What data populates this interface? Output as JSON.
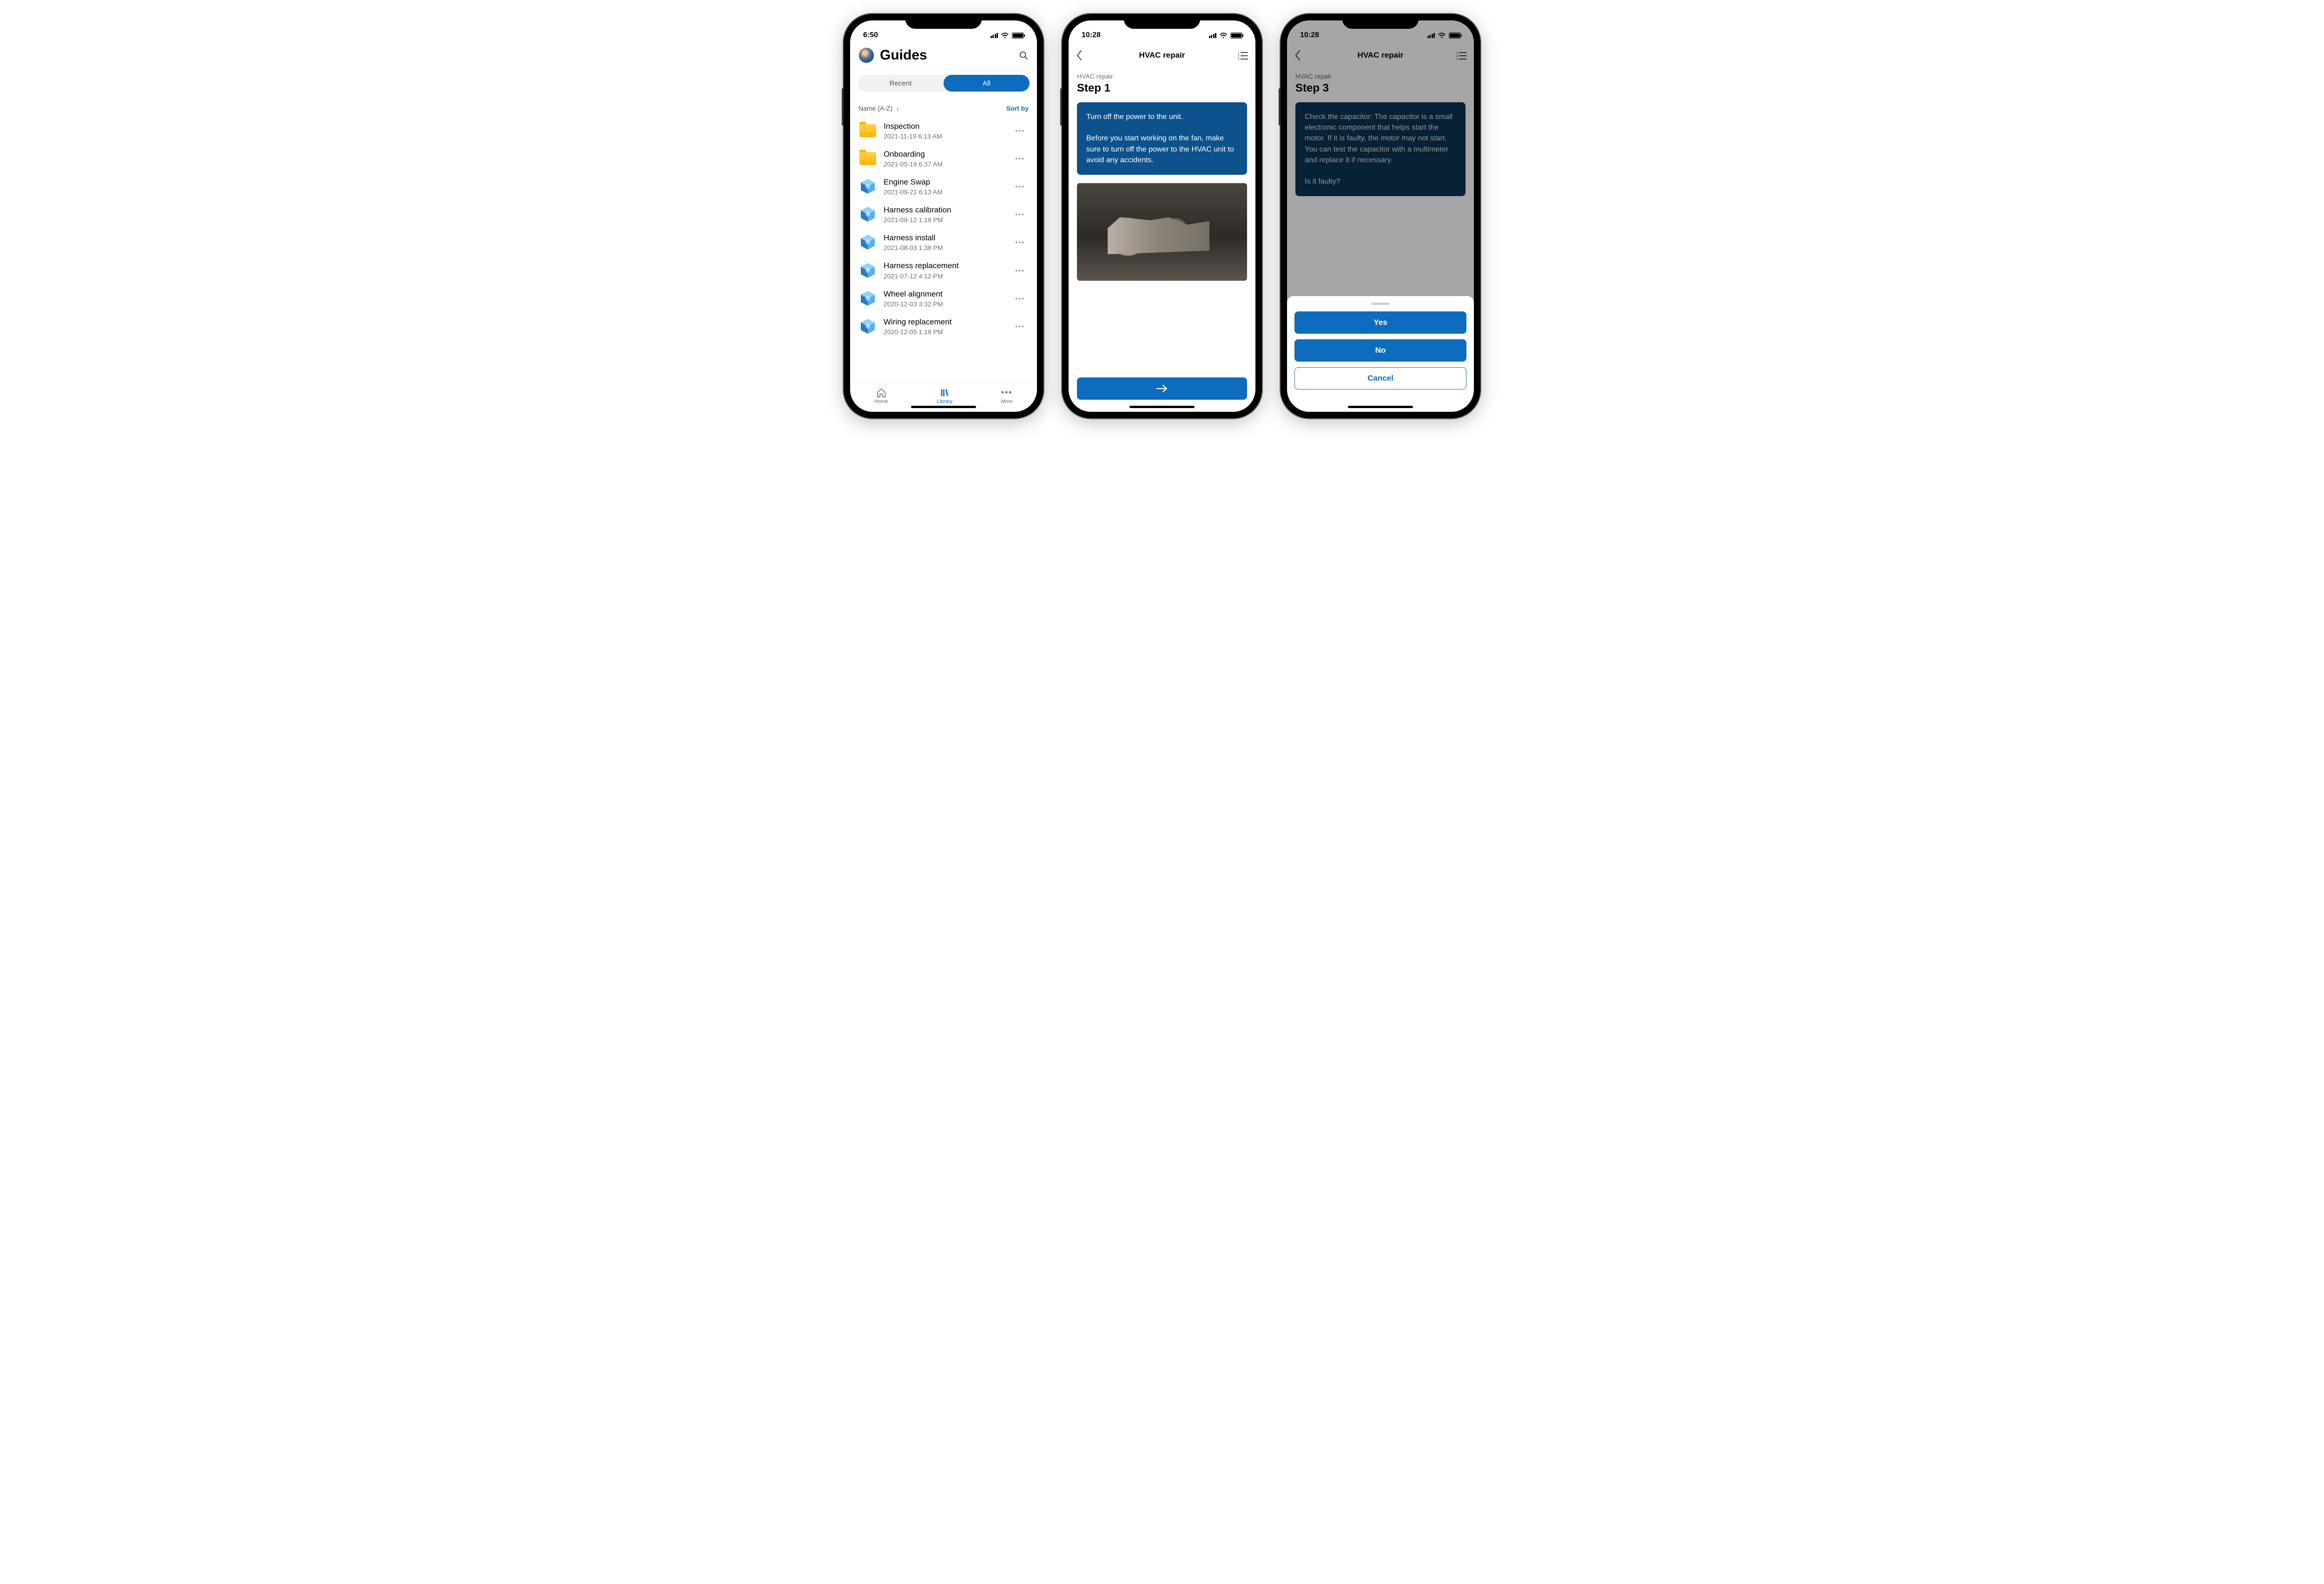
{
  "phone1": {
    "time": "6:50",
    "title": "Guides",
    "segmented": {
      "recent": "Recent",
      "all": "All"
    },
    "sort_label": "Name (A-Z)",
    "sort_by": "Sort by",
    "items": [
      {
        "type": "folder",
        "title": "Inspection",
        "sub": "2021-11-19 6:13 AM"
      },
      {
        "type": "folder",
        "title": "Onboarding",
        "sub": "2021-05-19 6:37 AM"
      },
      {
        "type": "guide",
        "title": "Engine Swap",
        "sub": "2021-09-21 6:13 AM"
      },
      {
        "type": "guide",
        "title": "Harness calibration",
        "sub": "2021-08-12 1:18 PM"
      },
      {
        "type": "guide",
        "title": "Harness install",
        "sub": "2021-08-03 1:38 PM"
      },
      {
        "type": "guide",
        "title": "Harness replacement",
        "sub": "2021-07-12 4:12 PM"
      },
      {
        "type": "guide",
        "title": "Wheel alignment",
        "sub": "2020-12-03 3:32 PM"
      },
      {
        "type": "guide",
        "title": "Wiring replacement",
        "sub": "2020-12-05 1:18 PM"
      }
    ],
    "tabs": {
      "home": "Home",
      "library": "Library",
      "more": "More"
    }
  },
  "phone2": {
    "time": "10:28",
    "nav_title": "HVAC repair",
    "crumb": "HVAC repair",
    "step": "Step 1",
    "card": "Turn off the power to the unit.\n\nBefore you start working on the fan, make sure to turn off the power to the HVAC unit to avoid any accidents."
  },
  "phone3": {
    "time": "10:28",
    "nav_title": "HVAC repair",
    "crumb": "HVAC repair",
    "step": "Step 3",
    "card": "Check the capacitor: The capacitor is a small electronic component that helps start the motor. If it is faulty, the motor may not start. You can test the capacitor with a multimeter and replace it if necessary.\n\nIs it faulty?",
    "actions": {
      "yes": "Yes",
      "no": "No",
      "cancel": "Cancel"
    }
  }
}
